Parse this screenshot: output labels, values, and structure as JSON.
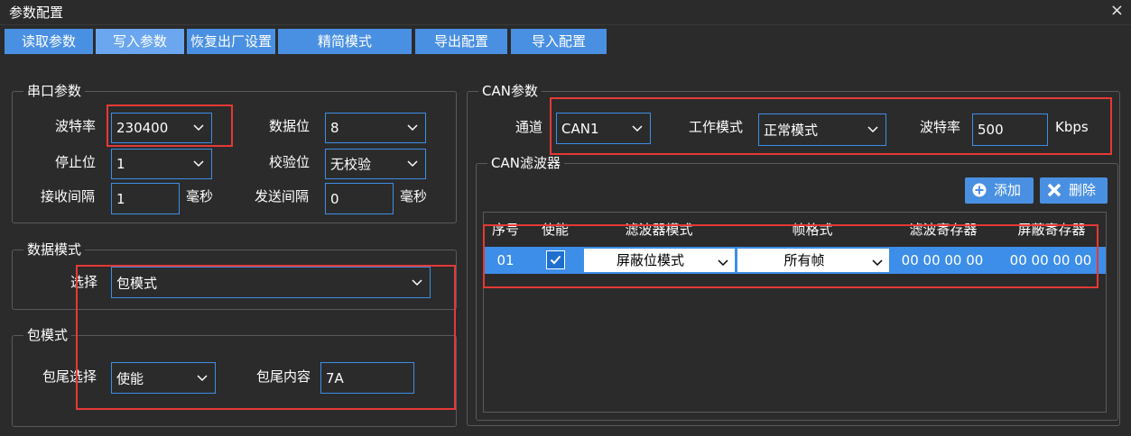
{
  "window": {
    "title": "参数配置",
    "close": "×"
  },
  "toolbar": {
    "buttons": [
      "读取参数",
      "写入参数",
      "恢复出厂设置",
      "精简模式",
      "导出配置",
      "导入配置"
    ]
  },
  "serial": {
    "title": "串口参数",
    "baud_label": "波特率",
    "baud_value": "230400",
    "databits_label": "数据位",
    "databits_value": "8",
    "stopbits_label": "停止位",
    "stopbits_value": "1",
    "parity_label": "校验位",
    "parity_value": "无校验",
    "recv_interval_label": "接收间隔",
    "recv_interval_value": "1",
    "recv_unit": "毫秒",
    "send_interval_label": "发送间隔",
    "send_interval_value": "0",
    "send_unit": "毫秒"
  },
  "data_mode": {
    "title": "数据模式",
    "select_label": "选择",
    "select_value": "包模式"
  },
  "packet_mode": {
    "title": "包模式",
    "tail_select_label": "包尾选择",
    "tail_select_value": "使能",
    "tail_content_label": "包尾内容",
    "tail_content_value": "7A"
  },
  "can": {
    "title": "CAN参数",
    "channel_label": "通道",
    "channel_value": "CAN1",
    "workmode_label": "工作模式",
    "workmode_value": "正常模式",
    "baud_label": "波特率",
    "baud_value": "500",
    "baud_unit": "Kbps"
  },
  "can_filter": {
    "title": "CAN滤波器",
    "add_label": "添加",
    "delete_label": "删除",
    "columns": [
      "序号",
      "使能",
      "滤波器模式",
      "帧格式",
      "滤波寄存器",
      "屏蔽寄存器"
    ],
    "rows": [
      {
        "index": "01",
        "enabled": true,
        "mode": "屏蔽位模式",
        "frame": "所有帧",
        "filter_reg": "00 00 00 00",
        "mask_reg": "00 00 00 00"
      }
    ]
  },
  "colors": {
    "accent": "#4a90e2",
    "highlight": "#e53935",
    "background": "#2b2b2b"
  }
}
